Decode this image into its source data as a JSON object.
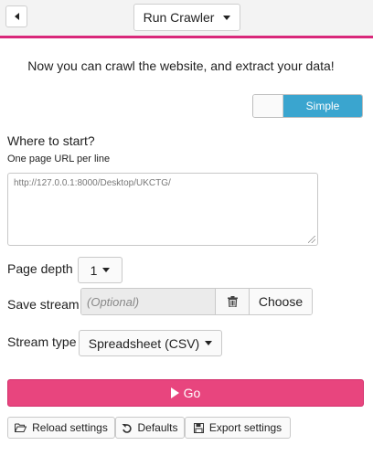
{
  "header": {
    "title": "Run Crawler"
  },
  "intro_text": "Now you can crawl the website, and extract your data!",
  "mode_toggle": {
    "label": "Simple"
  },
  "start": {
    "heading": "Where to start?",
    "hint": "One page URL per line",
    "url_value": "http://127.0.0.1:8000/Desktop/UKCTG/"
  },
  "page_depth": {
    "label": "Page depth",
    "value": "1"
  },
  "save_stream": {
    "label": "Save stream",
    "placeholder": "(Optional)",
    "choose_label": "Choose"
  },
  "stream_type": {
    "label": "Stream type",
    "value": "Spreadsheet (CSV)"
  },
  "go_label": "Go",
  "footer": {
    "reload_label": "Reload settings",
    "defaults_label": "Defaults",
    "export_label": "Export settings"
  },
  "colors": {
    "accent": "#e8457e",
    "toggle_on": "#3aa5cf",
    "header_border": "#d9287a"
  },
  "icons": [
    "chevron-left-icon",
    "caret-down-icon",
    "trash-icon",
    "play-icon",
    "folder-open-icon",
    "undo-icon",
    "save-icon"
  ]
}
